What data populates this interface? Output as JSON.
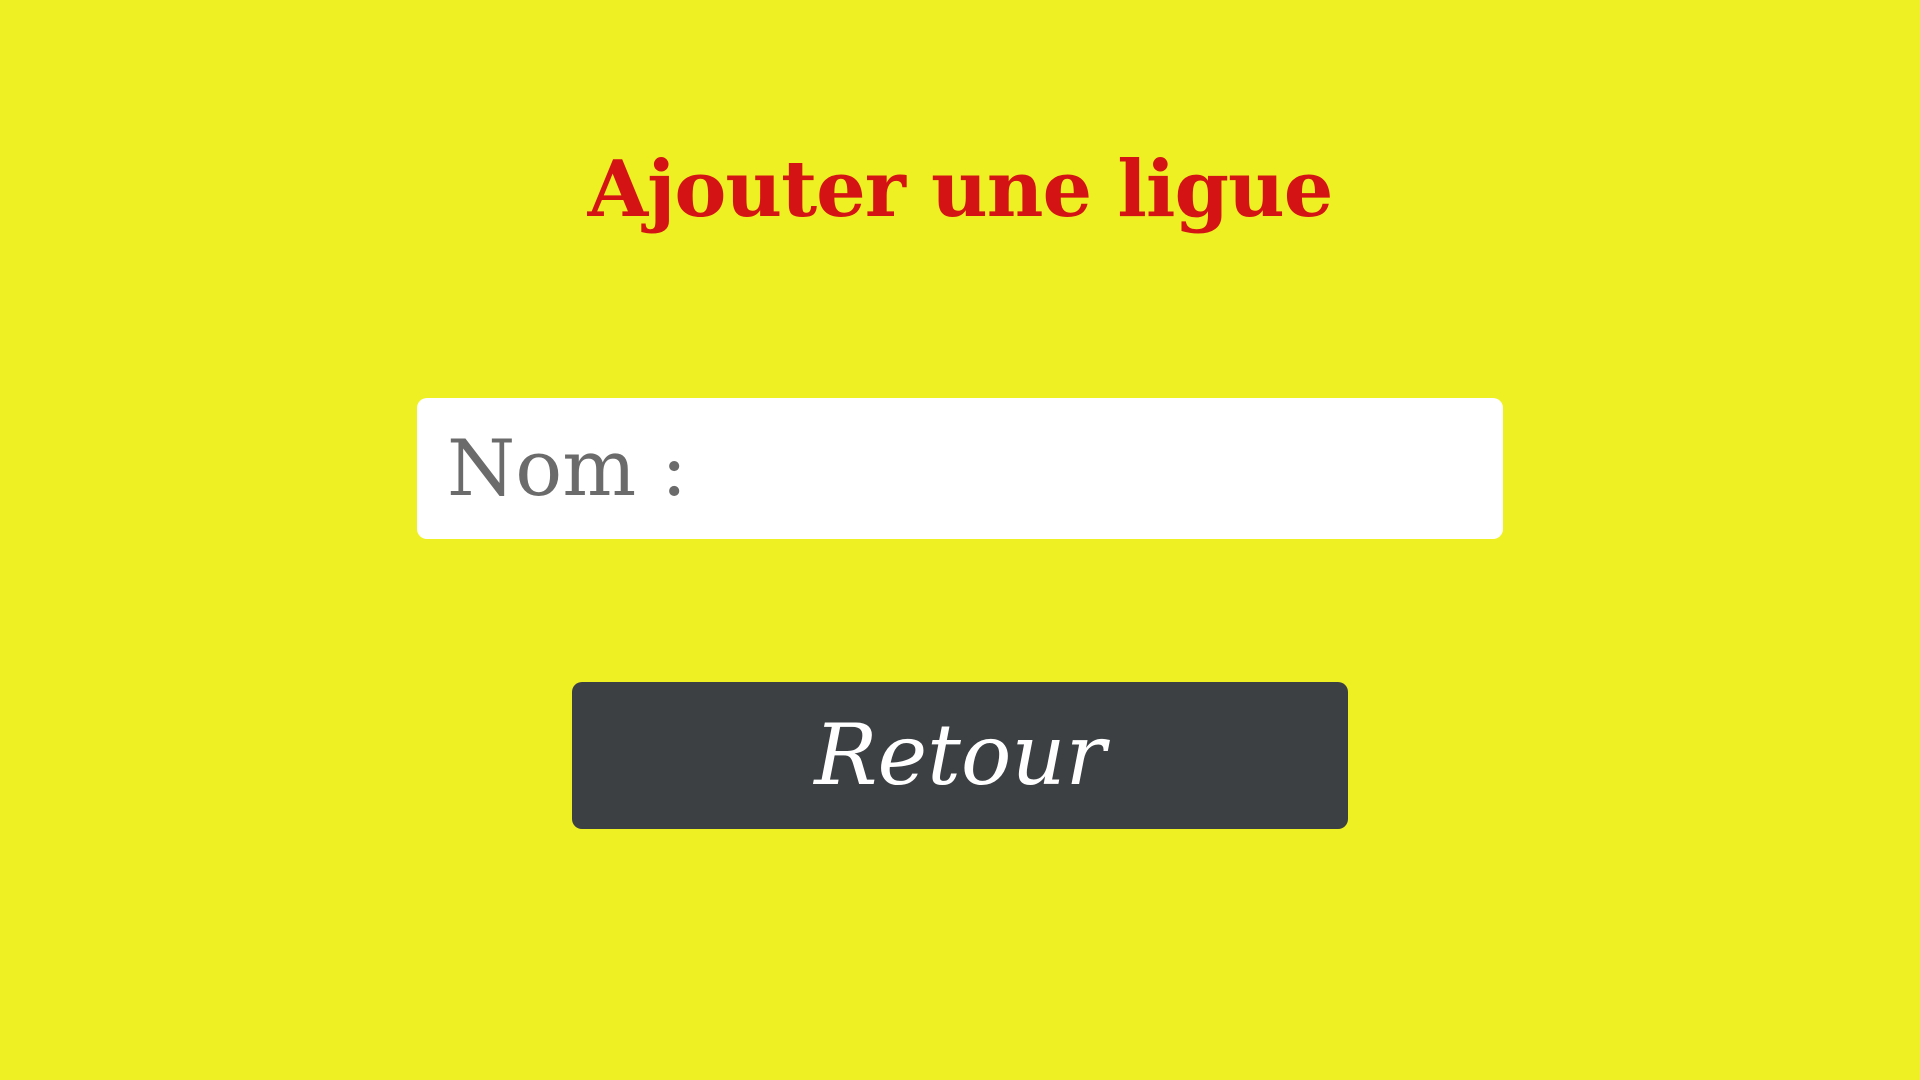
{
  "page": {
    "title": "Ajouter une ligue",
    "background_color": "#eef024",
    "title_color": "#d41414"
  },
  "form": {
    "name_field": {
      "placeholder": "Nom :",
      "value": ""
    }
  },
  "actions": {
    "back_label": "Retour",
    "back_color": "#3c4043"
  }
}
